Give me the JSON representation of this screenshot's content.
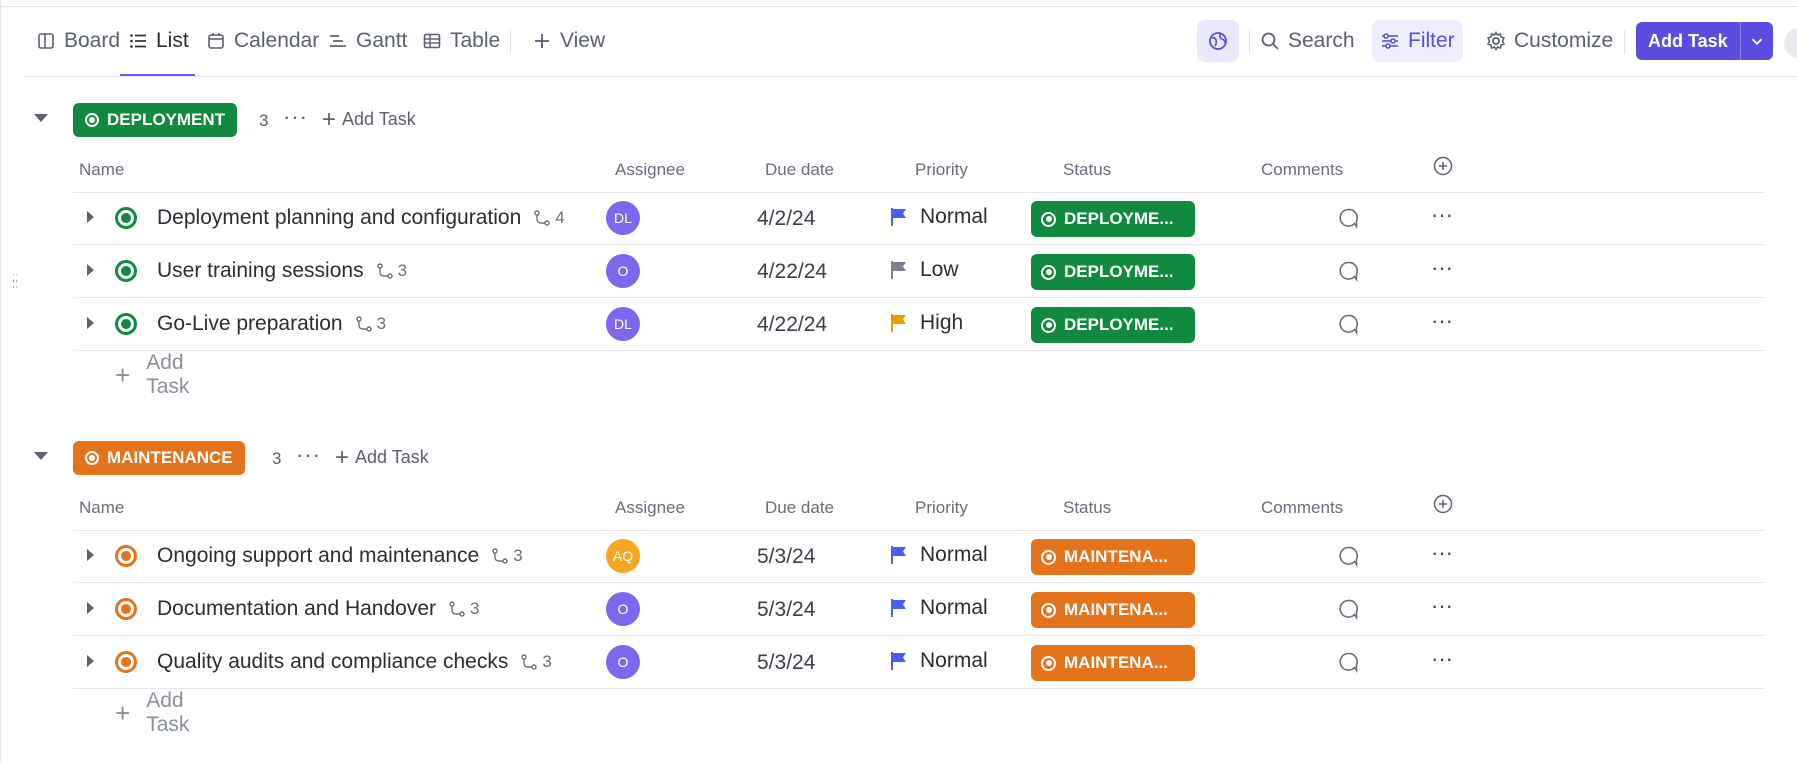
{
  "views": {
    "board": "Board",
    "list": "List",
    "calendar": "Calendar",
    "gantt": "Gantt",
    "table": "Table",
    "add_view": "View"
  },
  "toolbar": {
    "search": "Search",
    "filter": "Filter",
    "customize": "Customize",
    "add_task": "Add Task"
  },
  "columns": {
    "name": "Name",
    "assignee": "Assignee",
    "due": "Due date",
    "priority": "Priority",
    "status": "Status",
    "comments": "Comments"
  },
  "groups": [
    {
      "label": "DEPLOYMENT",
      "color": "#0f8a3e",
      "count": "3",
      "add_task": "Add Task",
      "tasks": [
        {
          "name": "Deployment planning and configuration",
          "subtasks": "4",
          "assignee": "DL",
          "avatar_color": "#7b68ee",
          "due": "4/2/24",
          "priority": "Normal",
          "flag": "#4b5cf0",
          "status": "DEPLOYME..."
        },
        {
          "name": "User training sessions",
          "subtasks": "3",
          "assignee": "O",
          "avatar_color": "#7b68ee",
          "due": "4/22/24",
          "priority": "Low",
          "flag": "#7d818b",
          "status": "DEPLOYME..."
        },
        {
          "name": "Go-Live preparation",
          "subtasks": "3",
          "assignee": "DL",
          "avatar_color": "#7b68ee",
          "due": "4/22/24",
          "priority": "High",
          "flag": "#e2a300",
          "status": "DEPLOYME..."
        }
      ],
      "add_row": "Add Task"
    },
    {
      "label": "MAINTENANCE",
      "color": "#e4731c",
      "count": "3",
      "add_task": "Add Task",
      "tasks": [
        {
          "name": "Ongoing support and maintenance",
          "subtasks": "3",
          "assignee": "AQ",
          "avatar_color": "#f5a623",
          "due": "5/3/24",
          "priority": "Normal",
          "flag": "#4b5cf0",
          "status": "MAINTENA..."
        },
        {
          "name": "Documentation and Handover",
          "subtasks": "3",
          "assignee": "O",
          "avatar_color": "#7b68ee",
          "due": "5/3/24",
          "priority": "Normal",
          "flag": "#4b5cf0",
          "status": "MAINTENA..."
        },
        {
          "name": "Quality audits and compliance checks",
          "subtasks": "3",
          "assignee": "O",
          "avatar_color": "#7b68ee",
          "due": "5/3/24",
          "priority": "Normal",
          "flag": "#4b5cf0",
          "status": "MAINTENA..."
        }
      ],
      "add_row": "Add Task"
    }
  ],
  "icons": [
    "board-icon",
    "list-icon",
    "calendar-icon",
    "gantt-icon",
    "table-icon",
    "plus-icon",
    "globe-icon",
    "search-icon",
    "filter-icon",
    "gear-icon",
    "chevron-down-icon",
    "subtask-icon",
    "flag-icon",
    "comment-icon",
    "more-icon",
    "add-column-icon",
    "drag-handle-icon"
  ]
}
